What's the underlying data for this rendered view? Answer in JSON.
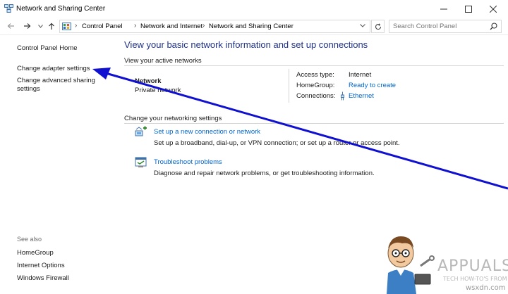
{
  "window": {
    "title": "Network and Sharing Center",
    "icon": "network-center-icon"
  },
  "address_bar": {
    "breadcrumbs": [
      "Control Panel",
      "Network and Internet",
      "Network and Sharing Center"
    ],
    "search_placeholder": "Search Control Panel"
  },
  "sidebar": {
    "home": "Control Panel Home",
    "links": [
      "Change adapter settings",
      "Change advanced sharing settings"
    ],
    "see_also_label": "See also",
    "see_also": [
      "HomeGroup",
      "Internet Options",
      "Windows Firewall"
    ]
  },
  "main": {
    "title": "View your basic network information and set up connections",
    "active_networks_label": "View your active networks",
    "network": {
      "name": "Network",
      "type": "Private network",
      "access_type_label": "Access type:",
      "access_type": "Internet",
      "homegroup_label": "HomeGroup:",
      "homegroup": "Ready to create",
      "connections_label": "Connections:",
      "connections": "Ethernet"
    },
    "change_settings_label": "Change your networking settings",
    "tasks": [
      {
        "icon": "new-connection-icon",
        "title": "Set up a new connection or network",
        "description": "Set up a broadband, dial-up, or VPN connection; or set up a router or access point."
      },
      {
        "icon": "troubleshoot-icon",
        "title": "Troubleshoot problems",
        "description": "Diagnose and repair network problems, or get troubleshooting information."
      }
    ]
  },
  "watermark": {
    "brand": "APPUALS",
    "tagline": "TECH HOW-TO'S FROM",
    "site": "wsxdn.com"
  },
  "colors": {
    "title_blue": "#1e3287",
    "link_blue": "#0066cc",
    "arrow_blue": "#1010d0"
  }
}
